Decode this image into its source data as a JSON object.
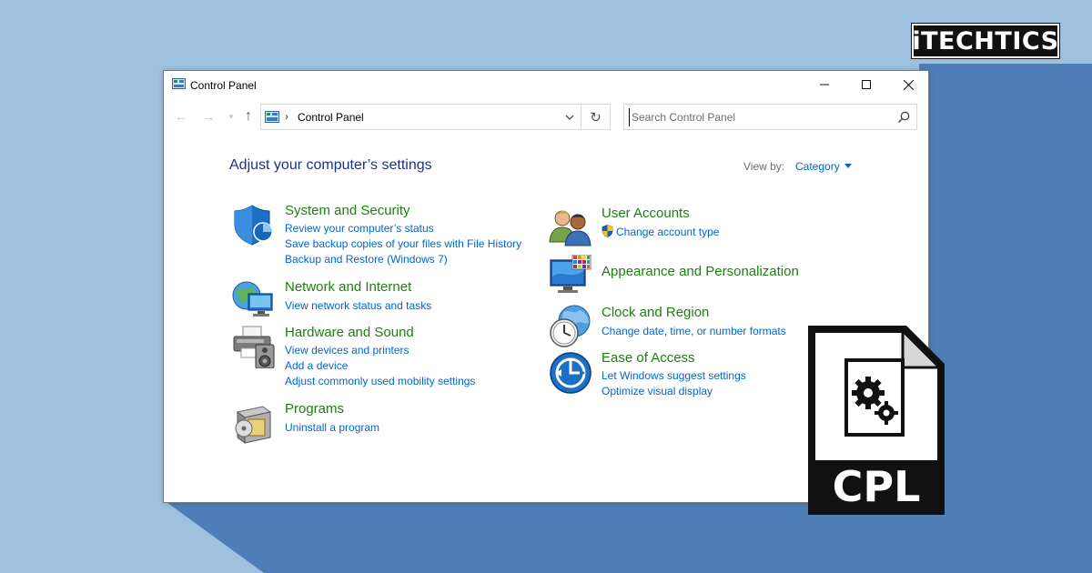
{
  "brand": {
    "logo_text": "iTECHTICS"
  },
  "window": {
    "title": "Control Panel",
    "controls": {
      "minimize": "minimize-icon",
      "maximize": "maximize-icon",
      "close": "close-icon"
    }
  },
  "nav": {
    "address": "Control Panel",
    "search_placeholder": "Search Control Panel"
  },
  "main": {
    "heading": "Adjust your computer’s settings",
    "view_by_label": "View by:",
    "view_by_value": "Category",
    "categories_left": [
      {
        "title": "System and Security",
        "icon": "shield-icon",
        "links": [
          "Review your computer’s status",
          "Save backup copies of your files with File History",
          "Backup and Restore (Windows 7)"
        ]
      },
      {
        "title": "Network and Internet",
        "icon": "network-globe-icon",
        "links": [
          "View network status and tasks"
        ]
      },
      {
        "title": "Hardware and Sound",
        "icon": "printer-speaker-icon",
        "links": [
          "View devices and printers",
          "Add a device",
          "Adjust commonly used mobility settings"
        ]
      },
      {
        "title": "Programs",
        "icon": "programs-box-icon",
        "links": [
          "Uninstall a program"
        ]
      }
    ],
    "categories_right": [
      {
        "title": "User Accounts",
        "icon": "users-icon",
        "links": [
          "Change account type"
        ]
      },
      {
        "title": "Appearance and Personalization",
        "icon": "monitor-palette-icon",
        "links": []
      },
      {
        "title": "Clock and Region",
        "icon": "clock-globe-icon",
        "links": [
          "Change date, time, or number formats"
        ]
      },
      {
        "title": "Ease of Access",
        "icon": "ease-of-access-icon",
        "links": [
          "Let Windows suggest settings",
          "Optimize visual display"
        ]
      }
    ]
  },
  "file_icon": {
    "label": "CPL",
    "icon": "cpl-file-gears-icon"
  },
  "colors": {
    "background_light": "#9ec1e0",
    "background_dark": "#4f7db8",
    "heading": "#1e3287",
    "category_title": "#1e7e12",
    "link": "#0066cc"
  }
}
